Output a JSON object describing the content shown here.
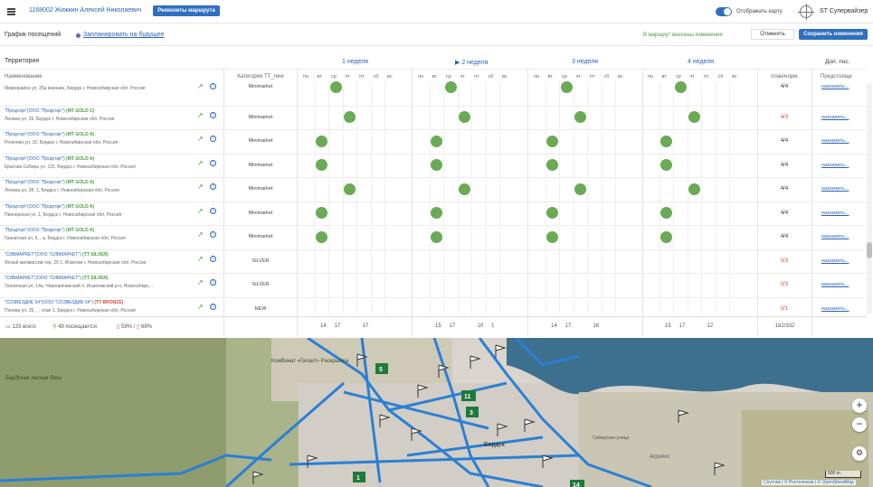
{
  "topbar": {
    "agent": "1168002 Жижкин Алексей Николаевич",
    "route_button": "Реквизиты маршрута",
    "show_map": "Отображать карту",
    "user": "ST Супервайзер"
  },
  "toolbar": {
    "title": "График посещений",
    "planned_link": "Запланировать на будущее",
    "changes": "В маршрут внесены изменения",
    "cancel": "Отменить",
    "save": "Сохранить изменения"
  },
  "header": {
    "territory": "Территория",
    "name_col": "Наименование",
    "category_col": "Категория TT_new",
    "weeks": [
      "1 неделя",
      "▶ 2 неделя",
      "3 неделя",
      "4 неделя"
    ],
    "days": [
      "пн",
      "вт",
      "ср",
      "чт",
      "пт",
      "сб",
      "вс"
    ],
    "plan_col": "план/норм.",
    "extra": "Доп. пос.",
    "upcoming": "Предстояще"
  },
  "rows": [
    {
      "name": "",
      "tag": "",
      "address": "Микрорайон ул, 25а магазин, Бердск г, Новосибирская обл, Россия",
      "category": "Minimarket",
      "plan": "4/4",
      "plan_color": "#333",
      "days": [
        1
      ]
    },
    {
      "name": "\"Продторг\"(ООО \"Продторг\")",
      "tag": "(МТ GOLD C)",
      "tag_class": "gold",
      "address": "Ленина ул, 39, Бердск г, Новосибирская обл, Россия",
      "category": "Minimarket",
      "plan": "4/3",
      "plan_color": "#d9473b",
      "days": [
        2
      ]
    },
    {
      "name": "\"Продторг\"(ООО \"Продторг\")",
      "tag": "(МТ GOLD A)",
      "tag_class": "gold",
      "address": "Рогачева ул, 15, Бердск г, Новосибирская обл, Россия",
      "category": "Minimarket",
      "plan": "4/4",
      "plan_color": "#333",
      "days": [
        0
      ]
    },
    {
      "name": "\"Продторг\"(ООО \"Продторг\")",
      "tag": "(МТ GOLD A)",
      "tag_class": "gold",
      "address": "Красная Сибирь ул, 115, Бердск г, Новосибирская обл, Россия",
      "category": "Minimarket",
      "plan": "4/4",
      "plan_color": "#333",
      "days": [
        0
      ]
    },
    {
      "name": "\"Продторг\"(ООО \"Продторг\")",
      "tag": "(МТ GOLD A)",
      "tag_class": "gold",
      "address": "Ленина ул, 28, 1, Бердск г, Новосибирская обл, Россия",
      "category": "Minimarket",
      "plan": "4/4",
      "plan_color": "#333",
      "days": [
        2
      ]
    },
    {
      "name": "\"Продторг\"(ООО \"Продторг\")",
      "tag": "(МТ GOLD A)",
      "tag_class": "gold",
      "address": "Пионерская ул, 1, Бердск г, Новосибирская обл, Россия",
      "category": "Minimarket",
      "plan": "4/4",
      "plan_color": "#333",
      "days": [
        0
      ]
    },
    {
      "name": "\"Продторг\"(ООО \"Продторг\")",
      "tag": "(МТ GOLD A)",
      "tag_class": "gold",
      "address": "Гранитная ул, 6, , а, Бердск г, Новосибирская обл, Россия",
      "category": "Minimarket",
      "plan": "4/4",
      "plan_color": "#333",
      "days": [
        0
      ]
    },
    {
      "name": "\"СИБМАРКЕТ\"(ООО \"СИБМАРКЕТ\")",
      "tag": "(ТТ SILVER)",
      "tag_class": "gold",
      "address": "Ясный жилмассив тер, 25 1, Искитим г, Новосибирская обл, Россия",
      "category": "SILVER",
      "plan": "0/3",
      "plan_color": "#d9473b",
      "days": []
    },
    {
      "name": "\"СИБМАРКЕТ\"(ООО \"СИБМАРКЕТ\")",
      "tag": "(ТТ SILVER)",
      "tag_class": "gold",
      "address": "Тепличная ул, 14а, Черноречинский п, Искитимский р-н, Новосибирс...",
      "category": "SILVER",
      "plan": "0/3",
      "plan_color": "#d9473b",
      "days": []
    },
    {
      "name": "\"СОЗВЕЗДИЕ 54\"(ООО \"СОЗВЕЗДИЕ 54\")",
      "tag": "(ТТ BRONZE)",
      "tag_class": "bronze",
      "address": "Попова ул, 35, , , этаж 1, Бердск г, Новосибирская обл, Россия",
      "category": "NEW",
      "plan": "0/1",
      "plan_color": "#d9473b",
      "days": []
    }
  ],
  "assign_label": "назначить...",
  "footer": {
    "total": "133 всего",
    "visited": "49 посещаются",
    "percent_a": "59%",
    "percent_b": "68%",
    "week1": [
      "14",
      "17",
      "",
      "17"
    ],
    "week2": [
      "15",
      "17",
      "",
      "10",
      "1"
    ],
    "week3": [
      "14",
      "17",
      "",
      "16"
    ],
    "week4": [
      "15",
      "17",
      "",
      "12"
    ],
    "plan_total": "182/332"
  },
  "map": {
    "labels": [
      "Бердская лесная дача",
      "Комбинат «Гигант» Раскрыжка",
      "Бердск",
      "Сибирская улица",
      "Агропос"
    ],
    "markers": [
      "5",
      "11",
      "3",
      "1",
      "14"
    ],
    "scale": "500 m",
    "attribution": "Спутник | © Ростелеком | © OpenStreetMap"
  }
}
